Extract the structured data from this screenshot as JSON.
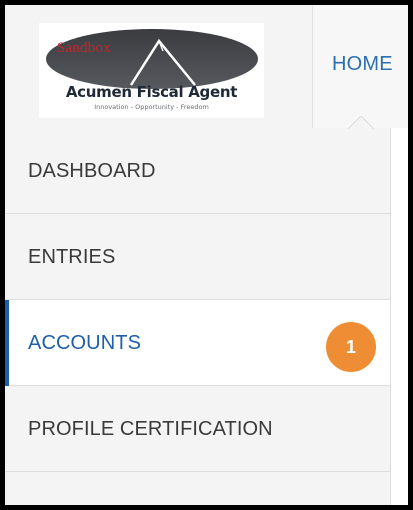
{
  "logo": {
    "watermark": "Sandbox",
    "company_name": "Acumen Fiscal Agent",
    "tagline": "Innovation - Opportunity - Freedom"
  },
  "header": {
    "home_tab_label": "HOME"
  },
  "sidebar": {
    "items": [
      {
        "label": "DASHBOARD",
        "active": false
      },
      {
        "label": "ENTRIES",
        "active": false
      },
      {
        "label": "ACCOUNTS",
        "active": true
      },
      {
        "label": "PROFILE CERTIFICATION",
        "active": false
      }
    ]
  },
  "step_badge": {
    "number": "1"
  },
  "colors": {
    "accent": "#1f5fa8",
    "home_text": "#2d6fae",
    "badge": "#ef8d34",
    "sidebar_bg": "#f4f4f4",
    "logo_red": "#c0282a"
  }
}
